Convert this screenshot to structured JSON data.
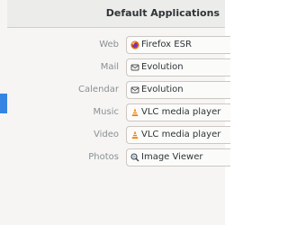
{
  "window": {
    "title": "Default Applications"
  },
  "rows": [
    {
      "label": "Web",
      "value": "Firefox ESR",
      "icon": "firefox-icon"
    },
    {
      "label": "Mail",
      "value": "Evolution",
      "icon": "evolution-icon"
    },
    {
      "label": "Calendar",
      "value": "Evolution",
      "icon": "evolution-icon"
    },
    {
      "label": "Music",
      "value": "VLC media player",
      "icon": "vlc-icon"
    },
    {
      "label": "Video",
      "value": "VLC media player",
      "icon": "vlc-icon"
    },
    {
      "label": "Photos",
      "value": "Image Viewer",
      "icon": "image-viewer-icon"
    }
  ],
  "colors": {
    "accent": "#3584e4",
    "firefox": "#e66000",
    "vlc": "#f57c00"
  }
}
